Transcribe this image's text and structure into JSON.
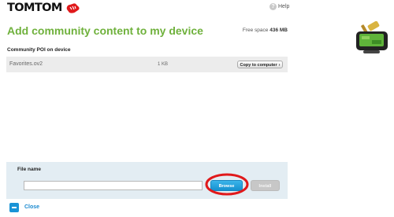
{
  "header": {
    "logo_text": "TOMTOM",
    "help_icon": "question-mark-icon",
    "help_label": "Help"
  },
  "main": {
    "title": "Add community content to my device",
    "free_space_label": "Free space",
    "free_space_value": "436 MB",
    "section_label": "Community POI on device",
    "poi_items": [
      {
        "name": "Favorites.ov2",
        "size": "1 KB",
        "action_label": "Copy to computer"
      }
    ]
  },
  "file_panel": {
    "label": "File name",
    "input_value": "",
    "browse_label": "Browse",
    "install_label": "Install"
  },
  "footer": {
    "close_label": "Close"
  },
  "colors": {
    "title_green": "#6fb13c",
    "accent_blue": "#1a93d6",
    "panel_blue": "#e3edf3",
    "highlight_red": "#e0191b"
  }
}
